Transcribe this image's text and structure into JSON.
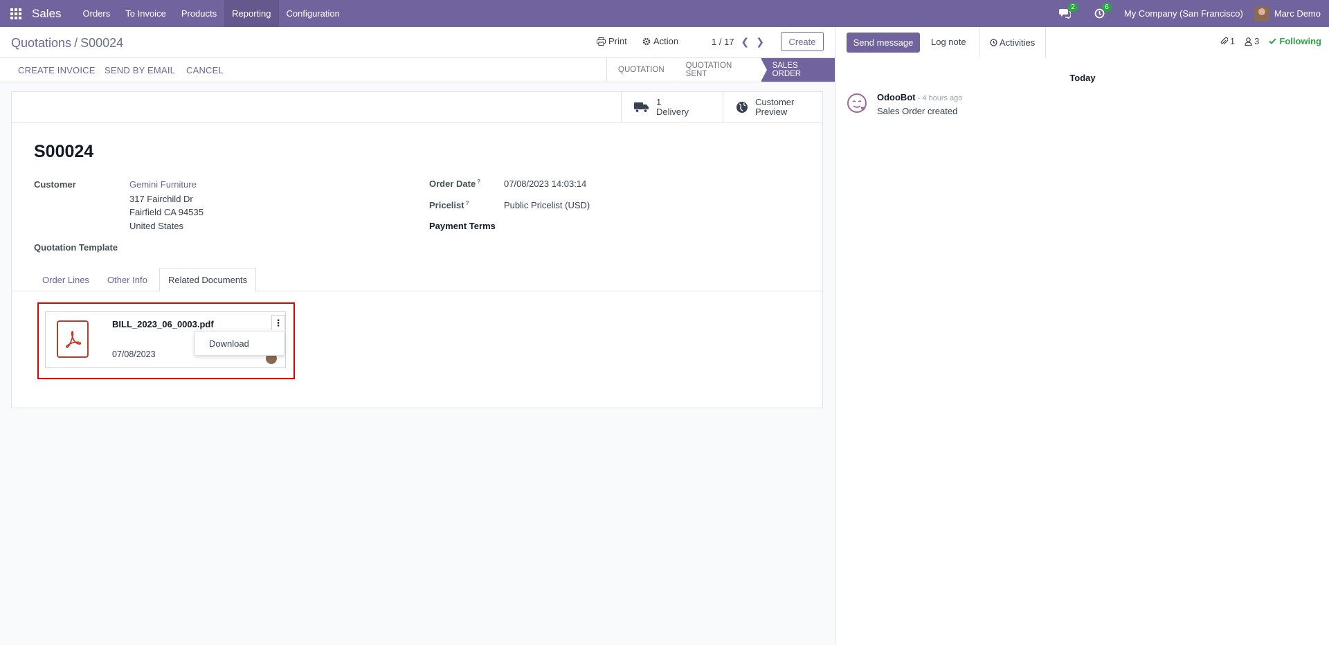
{
  "navbar": {
    "app_name": "Sales",
    "menu": [
      "Orders",
      "To Invoice",
      "Products",
      "Reporting",
      "Configuration"
    ],
    "messages_count": "2",
    "activities_count": "6",
    "company": "My Company (San Francisco)",
    "user": "Marc Demo"
  },
  "control": {
    "breadcrumb_parent": "Quotations",
    "breadcrumb_sep": "/",
    "breadcrumb_current": "S00024",
    "print_label": "Print",
    "action_label": "Action",
    "pager": "1 / 17",
    "create_label": "Create",
    "actions": [
      "CREATE INVOICE",
      "SEND BY EMAIL",
      "CANCEL"
    ],
    "stages": [
      "QUOTATION",
      "QUOTATION SENT",
      "SALES ORDER"
    ],
    "active_stage": "SALES ORDER"
  },
  "smart_buttons": {
    "delivery_count": "1",
    "delivery_label": "Delivery",
    "preview_line1": "Customer",
    "preview_line2": "Preview"
  },
  "form": {
    "title": "S00024",
    "customer_label": "Customer",
    "customer_name": "Gemini Furniture",
    "address_line1": "317 Fairchild Dr",
    "address_line2": "Fairfield CA 94535",
    "address_line3": "United States",
    "template_label": "Quotation Template",
    "order_date_label": "Order Date",
    "order_date": "07/08/2023 14:03:14",
    "pricelist_label": "Pricelist",
    "pricelist": "Public Pricelist (USD)",
    "payment_terms_label": "Payment Terms",
    "help_mark": "?"
  },
  "tabs": [
    "Order Lines",
    "Other Info",
    "Related Documents"
  ],
  "attachment": {
    "file_name": "BILL_2023_06_0003.pdf",
    "date": "07/08/2023",
    "menu_item": "Download"
  },
  "chatter": {
    "send_message": "Send message",
    "log_note": "Log note",
    "activities": "Activities",
    "attachments_count": "1",
    "followers_count": "3",
    "following": "Following",
    "date_separator": "Today",
    "message_author": "OdooBot",
    "message_time": "- 4 hours ago",
    "message_body": "Sales Order created"
  },
  "colors": {
    "brand": "#71639e",
    "highlight": "#e00000",
    "following": "#28a745"
  }
}
